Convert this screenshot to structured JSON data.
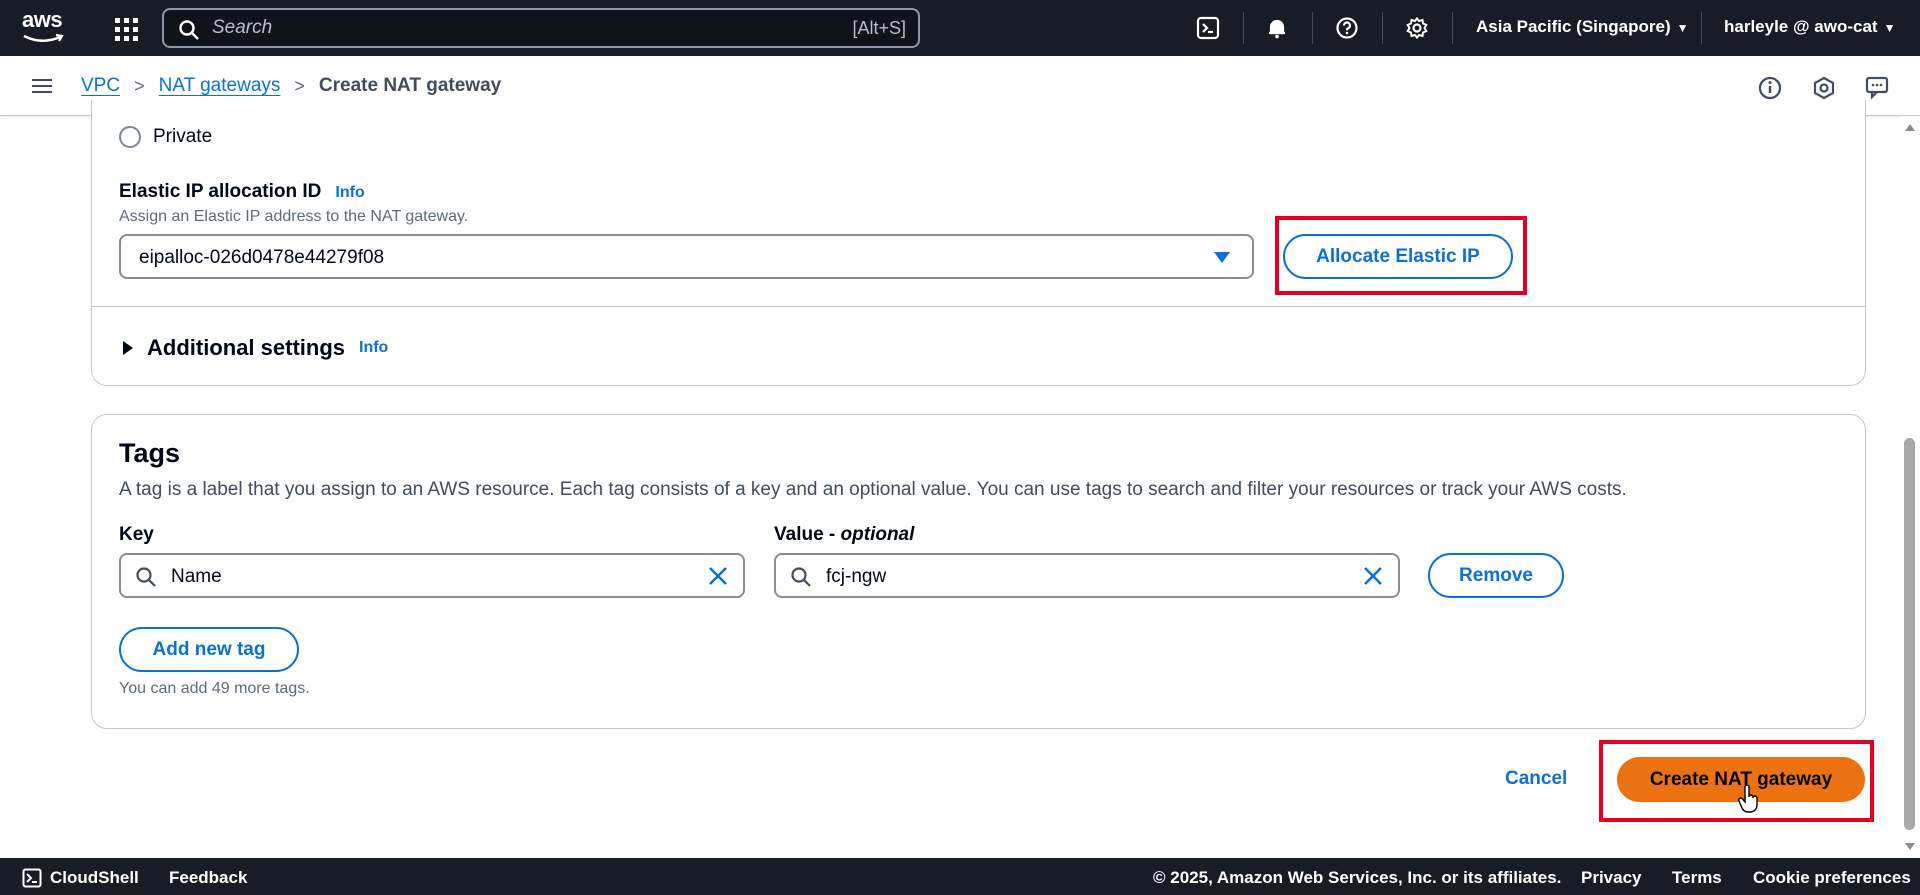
{
  "topnav": {
    "logo_text": "aws",
    "search_placeholder": "Search",
    "search_shortcut": "[Alt+S]",
    "region": "Asia Pacific (Singapore)",
    "user": "harleyle @ awo-cat"
  },
  "breadcrumb": {
    "items": [
      "VPC",
      "NAT gateways"
    ],
    "current": "Create NAT gateway"
  },
  "connectivity": {
    "private_label": "Private"
  },
  "elastic_ip": {
    "label": "Elastic IP allocation ID",
    "info": "Info",
    "description": "Assign an Elastic IP address to the NAT gateway.",
    "value": "eipalloc-026d0478e44279f08",
    "allocate_button": "Allocate Elastic IP"
  },
  "additional_settings": {
    "title": "Additional settings",
    "info": "Info"
  },
  "tags": {
    "title": "Tags",
    "description": "A tag is a label that you assign to an AWS resource. Each tag consists of a key and an optional value. You can use tags to search and filter your resources or track your AWS costs.",
    "key_label": "Key",
    "value_label": "Value - ",
    "value_label_optional": "optional",
    "key_value": "Name",
    "value_value": "fcj-ngw",
    "remove_button": "Remove",
    "add_button": "Add new tag",
    "hint": "You can add 49 more tags."
  },
  "actions": {
    "cancel": "Cancel",
    "create": "Create NAT gateway"
  },
  "footer": {
    "cloudshell": "CloudShell",
    "feedback": "Feedback",
    "copyright": "© 2025, Amazon Web Services, Inc. or its affiliates.",
    "privacy": "Privacy",
    "terms": "Terms",
    "cookies": "Cookie preferences"
  },
  "colors": {
    "nav_bg": "#161d26",
    "link": "#0972d3",
    "primary": "#ec7211",
    "highlight": "#e5001f"
  }
}
